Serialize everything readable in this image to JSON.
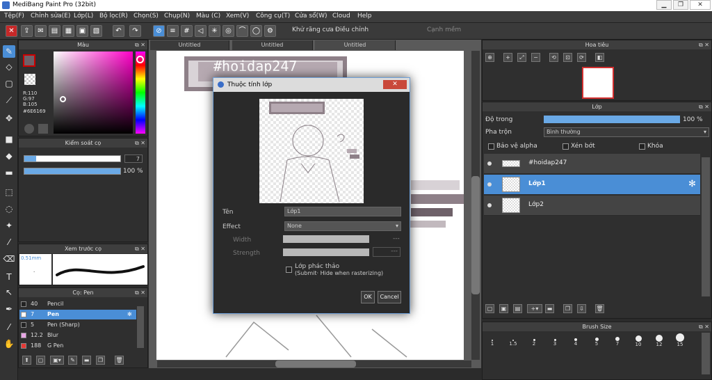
{
  "app": {
    "title": "MediBang Paint Pro (32bit)"
  },
  "menu": [
    "Tệp(F)",
    "Chỉnh sửa(E)",
    "Lớp(L)",
    "Bộ lọc(R)",
    "Chọn(S)",
    "Chụp(N)",
    "Màu (C)",
    "Xem(V)",
    "Công cụ(T)",
    "Cửa sổ(W)",
    "Cloud",
    "Help"
  ],
  "toolbar": {
    "antialias_label": "Khử răng cưa",
    "adjust_label": "Điều chỉnh",
    "adjust_value": "0",
    "snap_label": "Cạnh mềm"
  },
  "color_panel": {
    "title": "Màu",
    "r": "R:110",
    "g": "G:97",
    "b": "B:105",
    "hex": "#6E6169",
    "main_color": "#6E6169"
  },
  "brush_control": {
    "title": "Kiểm soát cọ",
    "size": "7",
    "opacity": "100 %",
    "opacity_value": 100
  },
  "brush_preview": {
    "title": "Xem trước cọ",
    "size_label": "0.51mm"
  },
  "brush_list": {
    "title": "Cọ: Pen",
    "items": [
      {
        "size": "40",
        "name": "Pencil",
        "color": "#222222"
      },
      {
        "size": "7",
        "name": "Pen",
        "color": "#ffffff"
      },
      {
        "size": "5",
        "name": "Pen (Sharp)",
        "color": "#222222"
      },
      {
        "size": "12.2",
        "name": "Blur",
        "color": "#e9a6e6"
      },
      {
        "size": "188",
        "name": "G Pen",
        "color": "#e53935"
      }
    ]
  },
  "tabs": [
    "Untitled",
    "Untitled",
    "Untitled"
  ],
  "canvas": {
    "watermark": "#hoidap247"
  },
  "dialog": {
    "title": "Thuộc tính lớp",
    "name_label": "Tên",
    "name_value": "Lớp1",
    "effect_label": "Effect",
    "effect_value": "None",
    "width_label": "Width",
    "strength_label": "Strength",
    "sketch_label": "Lớp phác thảo",
    "sketch_note": "(Submit· Hide when rasterizing)",
    "ok": "OK",
    "cancel": "Cancel",
    "preview_text": "#hoidap247"
  },
  "navigator": {
    "title": "Hoa tiêu"
  },
  "layer_panel": {
    "title": "Lớp",
    "opacity_label": "Độ trong",
    "opacity_value": "100 %",
    "opacity_fill": 100,
    "blend_label": "Pha trộn",
    "blend_value": "Bình thường",
    "protect_alpha": "Bảo vệ alpha",
    "clip": "Xén bớt",
    "lock": "Khóa",
    "layers": [
      {
        "name": "#hoidap247"
      },
      {
        "name": "Lớp1"
      },
      {
        "name": "Lớp2"
      }
    ]
  },
  "brush_size": {
    "title": "Brush Size",
    "sizes": [
      "1",
      "1.5",
      "2",
      "3",
      "4",
      "5",
      "7",
      "10",
      "12",
      "15"
    ]
  }
}
